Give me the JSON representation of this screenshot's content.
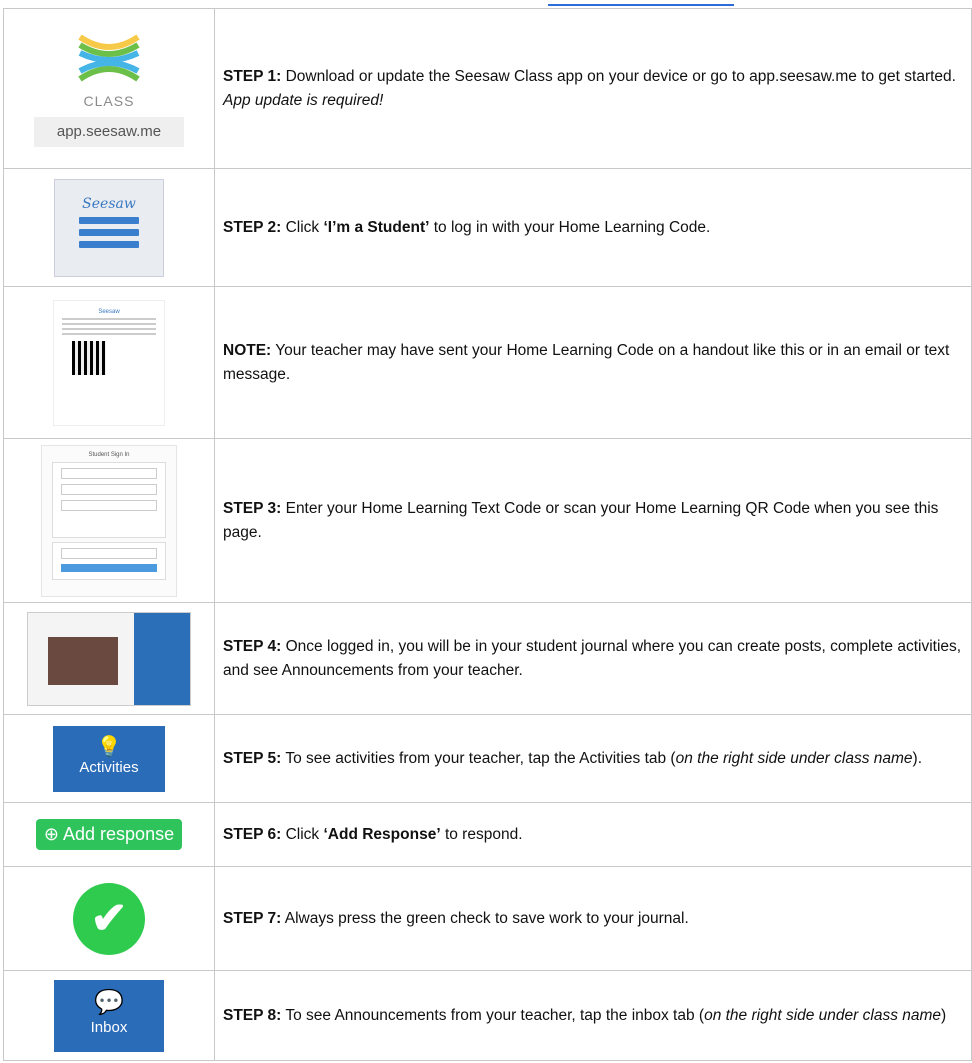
{
  "header": {
    "link_text": ""
  },
  "colors": {
    "tile_blue": "#2b6cb8",
    "green": "#2fc45b",
    "link_blue": "#2b6cd8"
  },
  "step1": {
    "image": {
      "brand": "CLASS",
      "url": "app.seesaw.me"
    },
    "label": "STEP 1:",
    "text": " Download or update the Seesaw Class app on your device or go to app.seesaw.me to get started. ",
    "emphasis": "App update is required!"
  },
  "step2": {
    "image": {
      "logo": "Seesaw"
    },
    "label": "STEP 2:",
    "text_a": " Click ",
    "quote": "‘I’m a Student’",
    "text_b": " to log in with your Home Learning Code."
  },
  "note": {
    "image": {
      "logo": "Seesaw"
    },
    "label": "NOTE:",
    "text": " Your teacher may have sent your Home Learning Code on a handout like this or in an email or text message."
  },
  "step3": {
    "image": {
      "title": "Student Sign In"
    },
    "label": "STEP 3:",
    "text": " Enter your Home Learning Text Code or scan your Home Learning QR Code when you see this page."
  },
  "step4": {
    "label": "STEP 4:",
    "text": " Once logged in, you will be in your student journal where you can create posts, complete activities, and see Announcements from your teacher."
  },
  "step5": {
    "image": {
      "tile_label": "Activities",
      "icon": "lightbulb-icon"
    },
    "label": "STEP 5:",
    "text": " To see activities from your teacher, tap the Activities tab (",
    "emphasis": "on the right side under class name",
    "text_end": ")."
  },
  "step6": {
    "image": {
      "button_label": "Add response",
      "icon": "plus-circle-icon"
    },
    "label": "STEP 6:",
    "text_a": " Click ",
    "quote": "‘Add Response’",
    "text_b": " to respond."
  },
  "step7": {
    "image": {
      "icon": "check-icon"
    },
    "label": "STEP 7:",
    "text": " Always press the green check to save work to your journal."
  },
  "step8": {
    "image": {
      "tile_label": "Inbox",
      "icon": "chat-bubbles-icon"
    },
    "label": "STEP 8:",
    "text": " To see Announcements from your teacher, tap the inbox tab (",
    "emphasis": "on the right side under class name",
    "text_end": ")"
  }
}
